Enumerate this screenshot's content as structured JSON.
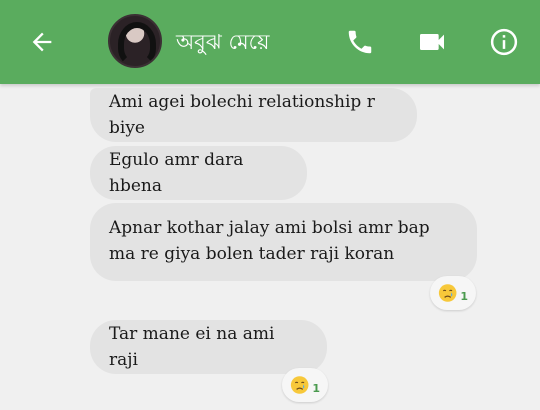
{
  "header": {
    "contact_name": "অবুঝ মেয়ে",
    "icons": [
      "back-arrow-icon",
      "avatar",
      "phone-icon",
      "video-camera-icon",
      "info-icon"
    ],
    "background_color": "#5aac5e"
  },
  "messages": [
    {
      "text": "Ami agei bolechi relationship r biye"
    },
    {
      "text": "Egulo amr dara hbena"
    },
    {
      "text": "Apnar kothar jalay ami bolsi amr bap ma re giya bolen tader raji koran",
      "reaction": {
        "emoji": "😢",
        "count": "1"
      }
    },
    {
      "text": "Tar mane ei na ami raji",
      "reaction": {
        "emoji": "😢",
        "count": "1"
      }
    }
  ]
}
